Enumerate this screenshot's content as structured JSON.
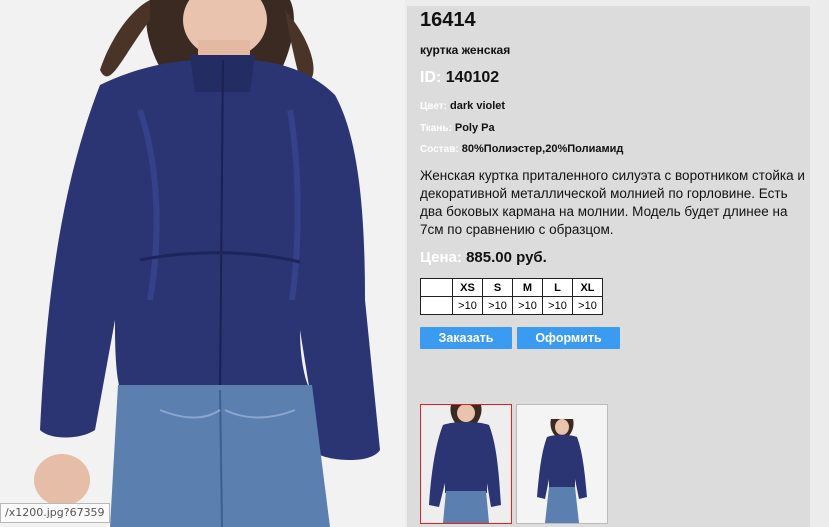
{
  "product": {
    "code": "16414",
    "name": "куртка женская",
    "id_label": "ID:",
    "id_value": "140102",
    "color_label": "Цвет:",
    "color_value": "dark violet",
    "fabric_label": "Ткань:",
    "fabric_value": "Poly Pa",
    "composition_label": "Состав:",
    "composition_value": "80%Полиэстер,20%Полиамид",
    "description": "Женская куртка приталенного силуэта с воротником стойка и декоративной металлической молнией по горловине. Есть два боковых кармана на молнии. Модель будет длинее на 7см по сравнению с образцом.",
    "price_label": "Цена:",
    "price_value": "885.00 руб."
  },
  "sizes": {
    "headers": [
      "XS",
      "S",
      "M",
      "L",
      "XL"
    ],
    "stock": [
      ">10",
      ">10",
      ">10",
      ">10",
      ">10"
    ]
  },
  "buttons": {
    "order": "Заказать",
    "checkout": "Оформить"
  },
  "status": {
    "url_tooltip": "/x1200.jpg?67359"
  },
  "colors": {
    "accent_button": "#3a9bf0",
    "jacket": "#2b3574",
    "panel_bg": "#dcdcdc",
    "thumb_active_border": "#dd2222"
  }
}
